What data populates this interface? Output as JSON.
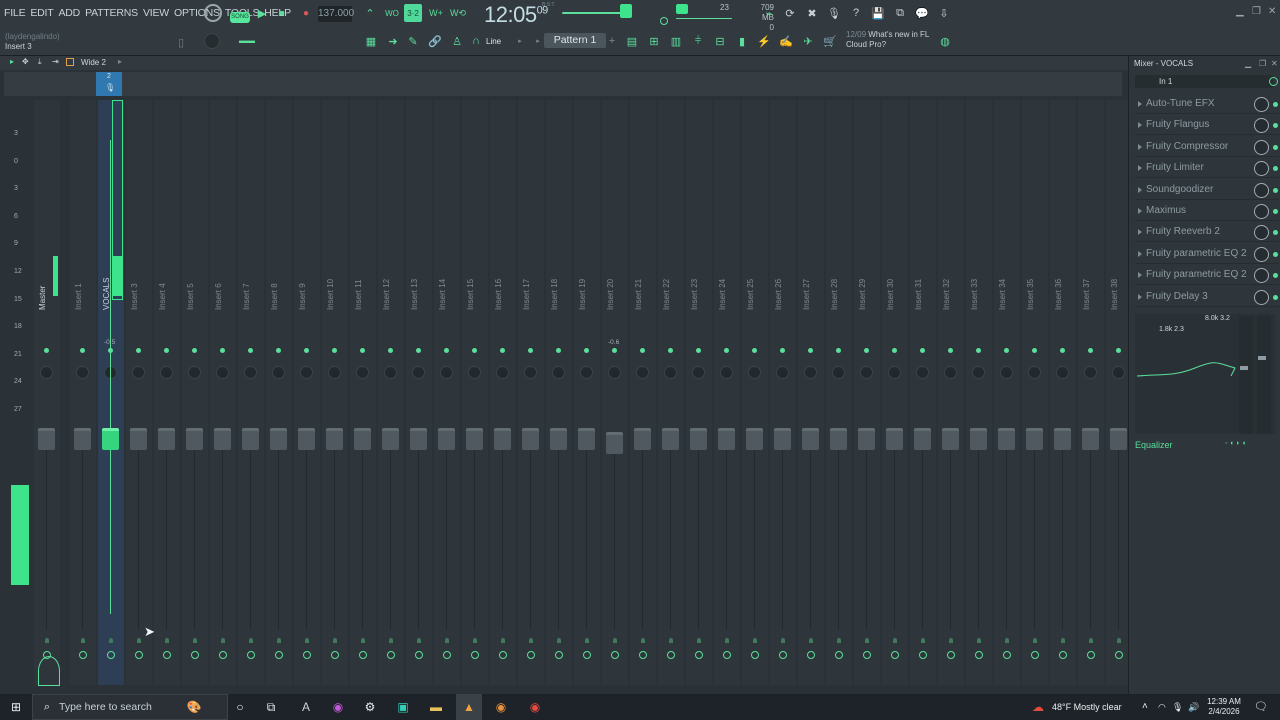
{
  "menu": [
    "FILE",
    "EDIT",
    "ADD",
    "PATTERNS",
    "VIEW",
    "OPTIONS",
    "TOOLS",
    "HELP"
  ],
  "user": {
    "name": "(laydengalindo)",
    "hint": "Insert 3"
  },
  "transport": {
    "mode": "SONG",
    "tempo": "137.000",
    "time": "12:05",
    "time_sub": "09",
    "time_top": "B:S:T"
  },
  "memory": {
    "cpu": "23",
    "ram": "709 MB",
    "zero": "0"
  },
  "toolbar": {
    "snap": "Line",
    "pattern": "Pattern 1"
  },
  "news": {
    "date": "12/09",
    "text": "What's new in FL",
    "text2": "Cloud Pro?"
  },
  "mixer": {
    "view": "Wide 2",
    "selected_index": "2",
    "scale": [
      "3",
      "0",
      "3",
      "6",
      "9",
      "12",
      "15",
      "18",
      "21",
      "24",
      "27"
    ],
    "values": {
      "vocals": "-0.5",
      "insert20": "-0.6"
    },
    "strips": [
      "Master",
      "Insert 1",
      "VOCALS",
      "Insert 3",
      "Insert 4",
      "Insert 5",
      "Insert 6",
      "Insert 7",
      "Insert 8",
      "Insert 9",
      "Insert 10",
      "Insert 11",
      "Insert 12",
      "Insert 13",
      "Insert 14",
      "Insert 15",
      "Insert 16",
      "Insert 17",
      "Insert 18",
      "Insert 19",
      "Insert 20",
      "Insert 21",
      "Insert 22",
      "Insert 23",
      "Insert 24",
      "Insert 25",
      "Insert 26",
      "Insert 27",
      "Insert 28",
      "Insert 29",
      "Insert 30",
      "Insert 31",
      "Insert 32",
      "Insert 33",
      "Insert 34",
      "Insert 35",
      "Insert 36",
      "Insert 37",
      "Insert 38"
    ]
  },
  "fx": {
    "title": "Mixer - VOCALS",
    "input": "In 1",
    "slots": [
      "Auto-Tune EFX",
      "Fruity Flangus",
      "Fruity Compressor",
      "Fruity Limiter",
      "Soundgoodizer",
      "Maximus",
      "Fruity Reeverb 2",
      "Fruity parametric EQ 2",
      "Fruity parametric EQ 2",
      "Fruity Delay 3"
    ],
    "eq_hint1": "8.0k 3.2",
    "eq_hint2": "1.8k 2.3",
    "eq_label": "Equalizer"
  },
  "taskbar": {
    "search_placeholder": "Type here to search",
    "weather": "48°F  Mostly clear",
    "time": "12:39 AM",
    "date": "2/4/2026"
  },
  "colors": {
    "accent": "#5bdf9b",
    "bg": "#2b3237",
    "selected": "#2e3e55"
  }
}
